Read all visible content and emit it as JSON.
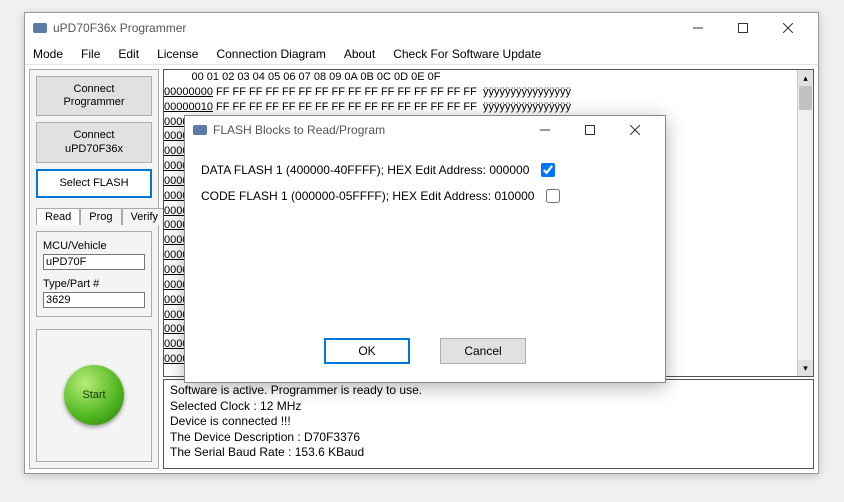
{
  "window": {
    "title": "uPD70F36x Programmer"
  },
  "menu": {
    "mode": "Mode",
    "file": "File",
    "edit": "Edit",
    "license": "License",
    "connection": "Connection Diagram",
    "about": "About",
    "update": "Check For Software Update"
  },
  "sidebar": {
    "connect_programmer": "Connect\nProgrammer",
    "connect_device": "Connect\nuPD70F36x",
    "select_flash": "Select FLASH"
  },
  "tabs": {
    "read": "Read",
    "prog": "Prog",
    "verify": "Verify"
  },
  "fields": {
    "mcu_label": "MCU/Vehicle",
    "mcu_value": "uPD70F",
    "type_label": "Type/Part #",
    "type_value": "3629"
  },
  "start": {
    "label": "Start"
  },
  "hex": {
    "header": "         00 01 02 03 04 05 06 07 08 09 0A 0B 0C 0D 0E 0F",
    "start_address": "00000000",
    "byte": "FF",
    "ascii_row": "ÿÿÿÿÿÿÿÿÿÿÿÿÿÿÿÿ",
    "rows": 19
  },
  "log": {
    "l1": "Software is active. Programmer is ready to use.",
    "l2": "Selected Clock : 12 MHz",
    "l3": "Device is connected !!!",
    "l4": "The Device Description : D70F3376",
    "l5": "The Serial Baud Rate : 153.6 KBaud"
  },
  "modal": {
    "title": "FLASH Blocks to Read/Program",
    "opt1": "DATA FLASH 1 (400000-40FFFF); HEX Edit Address: 000000",
    "opt1_checked": true,
    "opt2": "CODE FLASH 1 (000000-05FFFF); HEX Edit Address: 010000",
    "opt2_checked": false,
    "ok": "OK",
    "cancel": "Cancel"
  }
}
